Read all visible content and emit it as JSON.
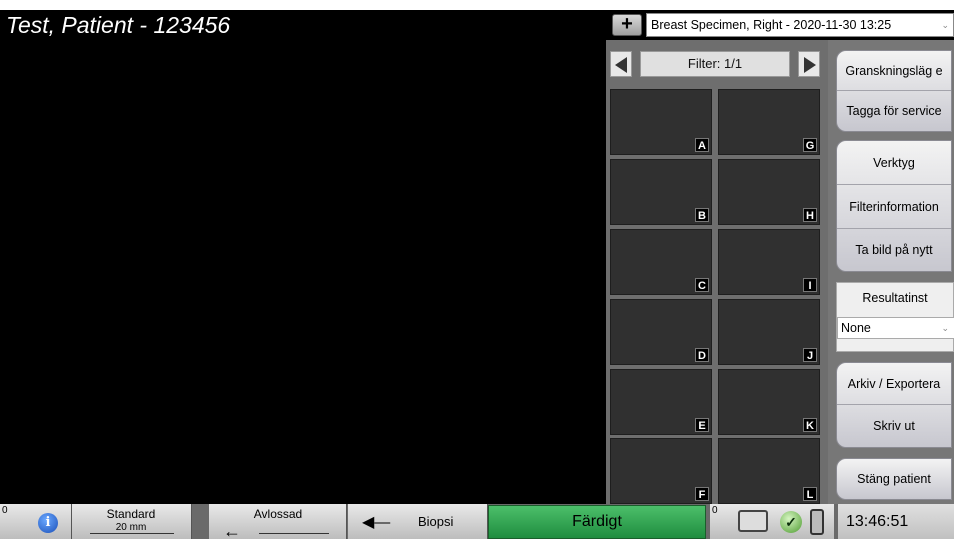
{
  "header": {
    "patient_title": "Test, Patient - 123456",
    "add_button_label": "+",
    "study_selected": "Breast Specimen, Right - 2020-11-30 13:25"
  },
  "filter": {
    "label": "Filter: 1/1"
  },
  "thumbnails": {
    "left": [
      "A",
      "B",
      "C",
      "D",
      "E",
      "F"
    ],
    "right": [
      "G",
      "H",
      "I",
      "J",
      "K",
      "L"
    ]
  },
  "sidebar": {
    "group1": [
      "Granskningsläg e",
      "Tagga för service"
    ],
    "group2": [
      "Verktyg",
      "Filterinformation",
      "Ta bild på nytt"
    ],
    "result_label": "Resultatinst",
    "result_value": "None",
    "group3": [
      "Arkiv / Exportera",
      "Skriv ut"
    ],
    "close_patient": "Stäng patient"
  },
  "statusbar": {
    "info_count": "0",
    "standard_label": "Standard",
    "standard_value": "20 mm",
    "release_label": "Avlossad",
    "biopsy_label": "Biopsi",
    "done_label": "Färdigt",
    "queue_count": "0",
    "time": "13:46:51"
  },
  "colors": {
    "done_green": "#2aa84f",
    "viewer_bg": "#000000",
    "thumb_bg": "#303030"
  }
}
